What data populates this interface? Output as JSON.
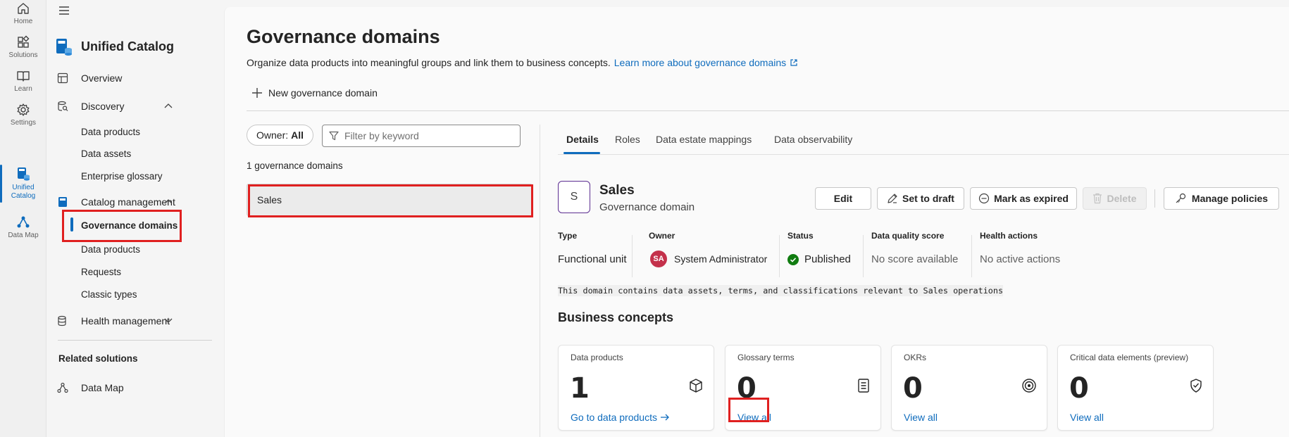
{
  "rail": [
    {
      "label": "Home",
      "icon": "home-icon"
    },
    {
      "label": "Solutions",
      "icon": "solutions-icon"
    },
    {
      "label": "Learn",
      "icon": "learn-icon"
    },
    {
      "label": "Settings",
      "icon": "settings-icon"
    },
    {
      "label": "Unified\nCatalog",
      "icon": "unified-catalog-icon"
    },
    {
      "label": "Data Map",
      "icon": "data-map-icon"
    }
  ],
  "nav": {
    "title": "Unified Catalog",
    "overview": "Overview",
    "discovery": "Discovery",
    "discovery_items": [
      "Data products",
      "Data assets",
      "Enterprise glossary"
    ],
    "catalog_management": "Catalog management",
    "catalog_items": [
      "Governance domains",
      "Data products",
      "Requests",
      "Classic types"
    ],
    "health_management": "Health management",
    "related_solutions": "Related solutions",
    "data_map": "Data Map"
  },
  "page": {
    "title": "Governance domains",
    "description": "Organize data products into meaningful groups and link them to business concepts.",
    "learn_more": "Learn more about governance domains",
    "new_button": "New governance domain",
    "owner_filter_label": "Owner:",
    "owner_filter_value": "All",
    "filter_placeholder": "Filter by keyword",
    "count_text": "1 governance domains",
    "domains": [
      "Sales"
    ]
  },
  "detail": {
    "tabs": [
      "Details",
      "Roles",
      "Data estate mappings",
      "Data observability"
    ],
    "avatar_letter": "S",
    "name": "Sales",
    "subtitle": "Governance domain",
    "buttons": {
      "edit": "Edit",
      "set_to_draft": "Set to draft",
      "mark_as_expired": "Mark as expired",
      "delete": "Delete",
      "manage_policies": "Manage policies"
    },
    "meta": {
      "type_label": "Type",
      "type_value": "Functional unit",
      "owner_label": "Owner",
      "owner_initials": "SA",
      "owner_value": "System Administrator",
      "status_label": "Status",
      "status_value": "Published",
      "dq_label": "Data quality score",
      "dq_value": "No score available",
      "health_label": "Health actions",
      "health_value": "No active actions"
    },
    "description": "This domain contains data assets, terms, and classifications relevant to Sales operations",
    "business_concepts_title": "Business concepts",
    "cards": [
      {
        "title": "Data products",
        "value": "1",
        "link": "Go to data products",
        "icon": "cube-icon"
      },
      {
        "title": "Glossary terms",
        "value": "0",
        "link": "View all",
        "icon": "document-icon"
      },
      {
        "title": "OKRs",
        "value": "0",
        "link": "View all",
        "icon": "target-icon"
      },
      {
        "title": "Critical data elements (preview)",
        "value": "0",
        "link": "View all",
        "icon": "shield-check-icon"
      }
    ]
  },
  "colors": {
    "accent": "#0f6cbd",
    "highlight_box": "#e02020",
    "published_green": "#107c10",
    "owner_avatar": "#c4314b",
    "domain_avatar_border": "#5c2e91"
  }
}
